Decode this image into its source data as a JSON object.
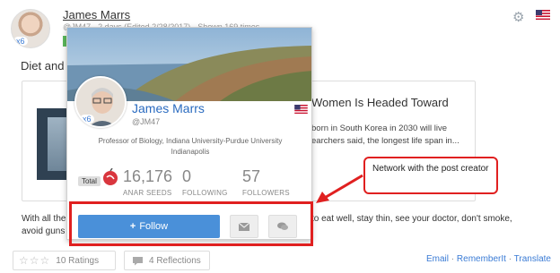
{
  "post": {
    "author": "James Marrs",
    "meta": "@JM47 · 2 days (Edited 2/28/2017) · Shown 169 times",
    "avatar_badge": "x6",
    "title_text": "Diet and",
    "body_line1": "With all the",
    "body_line1b": "to eat well, stay thin, see your doctor, don't smoke,",
    "body_line2": "avoid guns"
  },
  "article": {
    "heading": "Women Is Headed Toward",
    "snippet1": "born in South Korea in 2030 will live",
    "snippet2": "earchers said, the longest life span in..."
  },
  "footer": {
    "ratings_label": "10 Ratings",
    "reflections_label": "4 Reflections",
    "email_link": "Email",
    "rememberit_link": "RememberIt",
    "translate_link": "Translate",
    "separator": "·"
  },
  "profile_card": {
    "name": "James Marrs",
    "handle": "@JM47",
    "avatar_badge": "x6",
    "bio": "Professor of Biology, Indiana University-Purdue University Indianapolis",
    "total_label": "Total",
    "stats": {
      "seeds_value": "16,176",
      "seeds_label": "ANAR SEEDS",
      "following_value": "0",
      "following_label": "FOLLOWING",
      "followers_value": "57",
      "followers_label": "FOLLOWERS"
    },
    "follow_label": "Follow",
    "follow_icon": "+"
  },
  "annotation": {
    "callout_text": "Network with the post creator"
  },
  "colors": {
    "accent_blue": "#4a90d9",
    "link_blue": "#2a6bc0",
    "annotation_red": "#e02020"
  },
  "icons": [
    "gear-icon",
    "us-flag-icon",
    "star-icon",
    "comment-icon",
    "mail-icon",
    "chat-icon",
    "seed-icon",
    "plus-icon"
  ]
}
